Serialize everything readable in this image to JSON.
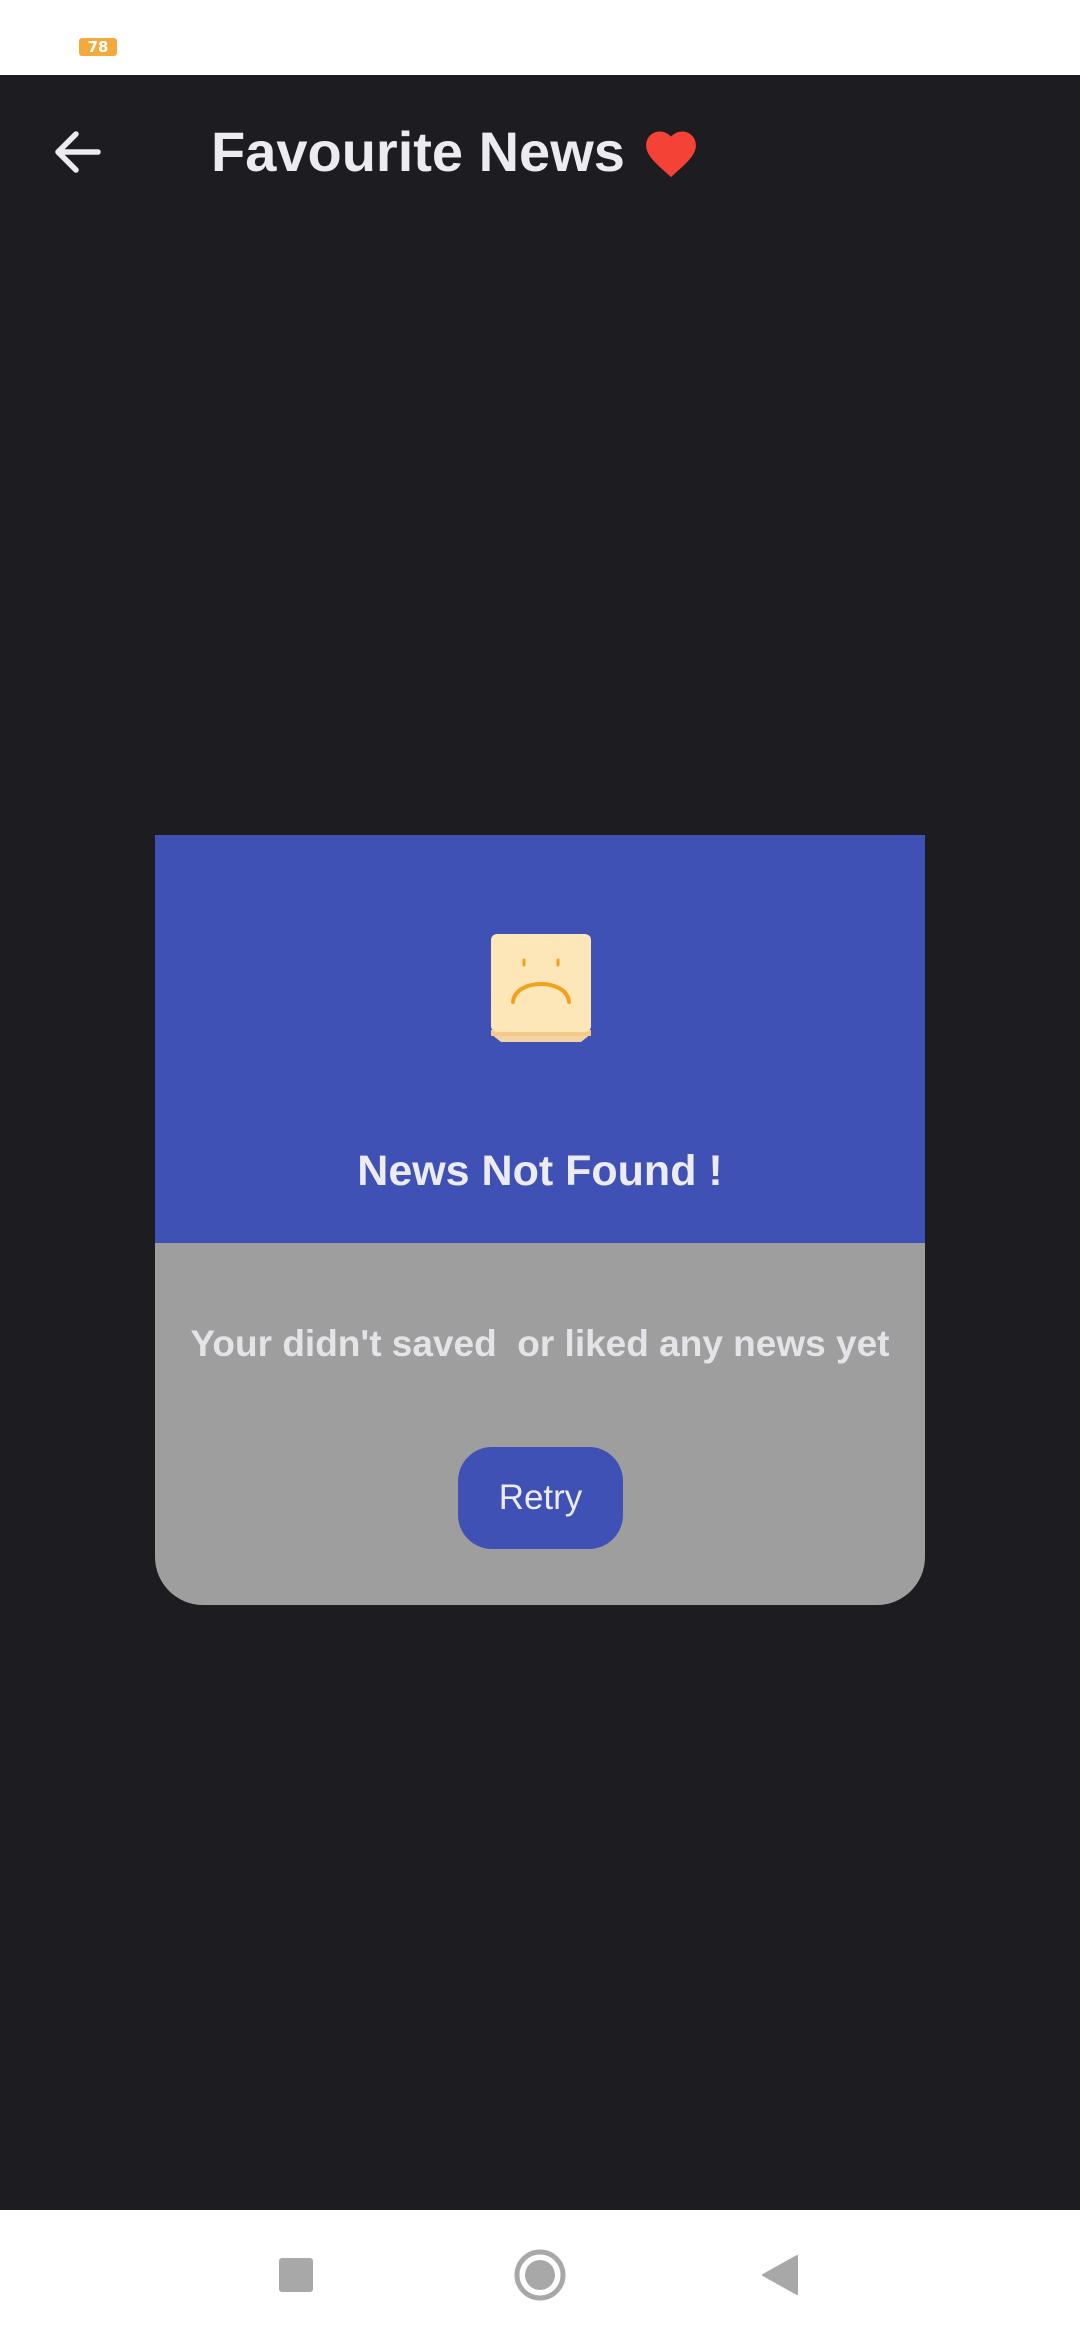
{
  "status_bar": {
    "battery_level": "78",
    "battery_color": "#f3a93b"
  },
  "app_bar": {
    "back_icon": "arrow-back-icon",
    "title": "Favourite News",
    "title_icon": "heart-icon",
    "title_icon_color": "#f44336"
  },
  "empty_state": {
    "icon": "sad-face-icon",
    "title": "News Not Found !",
    "message": "Your didn't saved  or liked any news yet",
    "retry_label": "Retry",
    "header_color": "#3f51b5",
    "body_color": "#9e9e9e"
  },
  "nav_bar": {
    "buttons": [
      "recents-square-icon",
      "home-circle-icon",
      "back-triangle-icon"
    ]
  }
}
